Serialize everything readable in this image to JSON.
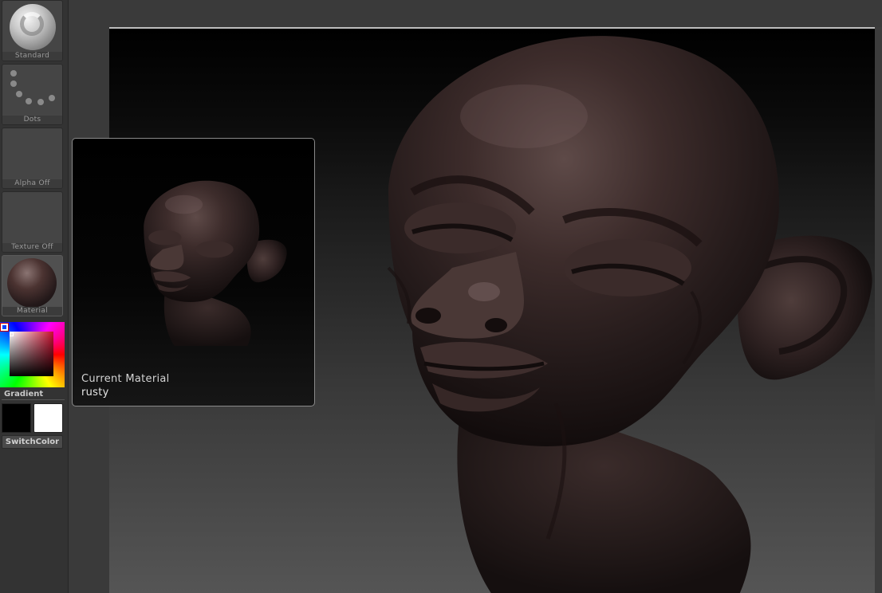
{
  "shelf": {
    "brush_label": "Standard",
    "stroke_label": "Dots",
    "alpha_label": "Alpha Off",
    "texture_label": "Texture Off",
    "material_label": "Material",
    "gradient_label": "Gradient",
    "switch_color_label": "SwitchColor",
    "main_color": "#c8102e",
    "secondary_color": "#ffffff"
  },
  "tooltip": {
    "title": "Current Material",
    "value": "rusty"
  }
}
